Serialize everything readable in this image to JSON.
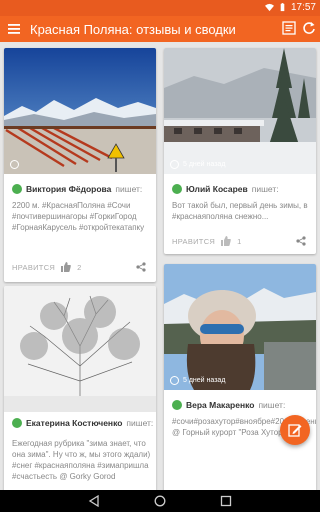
{
  "status": {
    "time": "17:57"
  },
  "app": {
    "title": "Красная Поляна: отзывы и сводки",
    "brand_color": "#f26522"
  },
  "cards": [
    {
      "author": "Виктория Фёдорова",
      "says": "пишет:",
      "time": "",
      "text": "2200 м. #КраснаяПоляна #Сочи #почтивершинагоры #ГоркиГород #ГорнаяКарусель #откройтекатапку",
      "like_label": "НРАВИТСЯ",
      "likes": "2"
    },
    {
      "author": "Юлий Косарев",
      "says": "пишет:",
      "time": "5 дней назад",
      "text": "Вот такой был, первый день зимы, в #краснаяполяна снежно...",
      "like_label": "НРАВИТСЯ",
      "likes": "1"
    },
    {
      "author": "Екатерина Костюченко",
      "says": "пишет:",
      "time": "",
      "text": "Ежегодная рубрика \"зима знает, что она зима\". Ну что ж, мы этого ждали) #снег #краснаяполяна #зимапришла #счастьесть @ Gorky Gorod",
      "like_label": "",
      "likes": ""
    },
    {
      "author": "Вера Макаренко",
      "says": "пишет:",
      "time": "5 дней назад",
      "text": "#сочи#розахутор#вноябре#2016#осень @ Горный курорт \"Роза Хутор\"",
      "like_label": "",
      "likes": ""
    }
  ]
}
